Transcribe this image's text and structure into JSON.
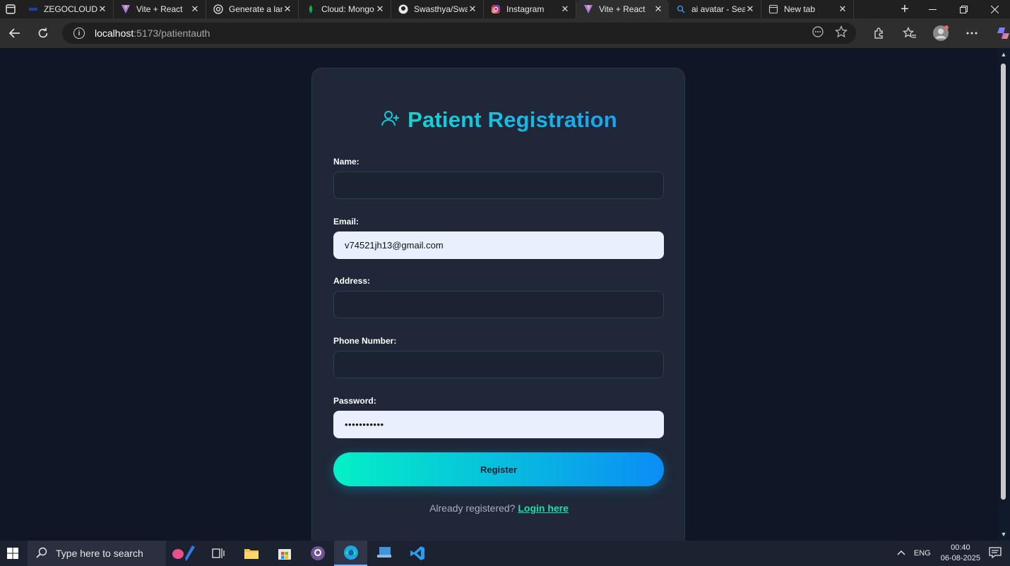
{
  "browser": {
    "tabs": [
      {
        "label": "ZEGOCLOUD C",
        "icon": "zegocloud-icon",
        "active": false
      },
      {
        "label": "Vite + React",
        "icon": "vite-icon",
        "active": false
      },
      {
        "label": "Generate a lan",
        "icon": "openai-icon",
        "active": false
      },
      {
        "label": "Cloud: Mongo",
        "icon": "mongodb-leaf-icon",
        "active": false
      },
      {
        "label": "Swasthya/Swas",
        "icon": "github-icon",
        "active": false
      },
      {
        "label": "Instagram",
        "icon": "instagram-icon",
        "active": false
      },
      {
        "label": "Vite + React",
        "icon": "vite-icon",
        "active": true
      },
      {
        "label": "ai avatar - Sear",
        "icon": "search-icon",
        "active": false
      },
      {
        "label": "New tab",
        "icon": "new-tab-page-icon",
        "active": false
      }
    ],
    "close_glyph": "✕",
    "new_tab_glyph": "+",
    "url_host": "localhost",
    "url_rest": ":5173/patientauth"
  },
  "form": {
    "title": "Patient Registration",
    "title_icon": "user-plus-icon",
    "name_label": "Name:",
    "name_value": "",
    "email_label": "Email:",
    "email_value": "v74521jh13@gmail.com",
    "address_label": "Address:",
    "address_value": "",
    "phone_label": "Phone Number:",
    "phone_value": "",
    "password_label": "Password:",
    "password_value": "•••••••••••",
    "register_label": "Register",
    "already_text": "Already registered?",
    "login_link": "Login here"
  },
  "taskbar": {
    "search_placeholder": "Type here to search",
    "language": "ENG",
    "time": "00:40",
    "date": "06-08-2025"
  },
  "colors": {
    "page_bg": "#0f1626",
    "card_bg": "#1f2738",
    "accent_start": "#04f0c6",
    "accent_end": "#0b8df5"
  }
}
